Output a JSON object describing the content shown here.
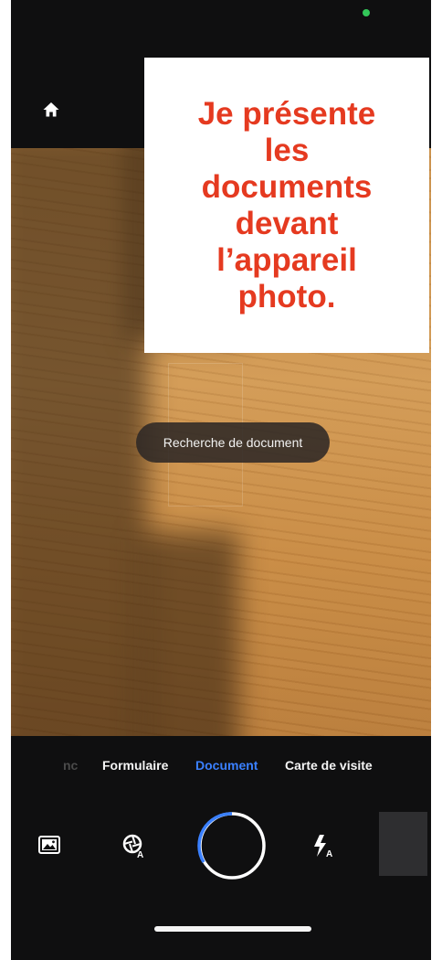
{
  "overlay": {
    "lines": [
      "Je présente",
      "les",
      "documents",
      "devant",
      "l’appareil",
      "photo."
    ]
  },
  "camera": {
    "status_text": "Recherche de document"
  },
  "modes": {
    "faded_partial": "nc",
    "items": [
      "Formulaire",
      "Document",
      "Carte de visite"
    ],
    "selected": "Document"
  },
  "toolbar": {
    "home_icon": "home-icon",
    "gallery_icon": "image-gallery-icon",
    "capture_mode_icon": "auto-capture-icon",
    "shutter_icon": "shutter-ring-icon",
    "flash_icon": "flash-auto-icon",
    "thumbnail": "last-capture-thumbnail"
  },
  "colors": {
    "accent": "#3a80ff",
    "overlay_text": "#e53a20",
    "status_dot": "#33c759",
    "background": "#0f0f10"
  }
}
